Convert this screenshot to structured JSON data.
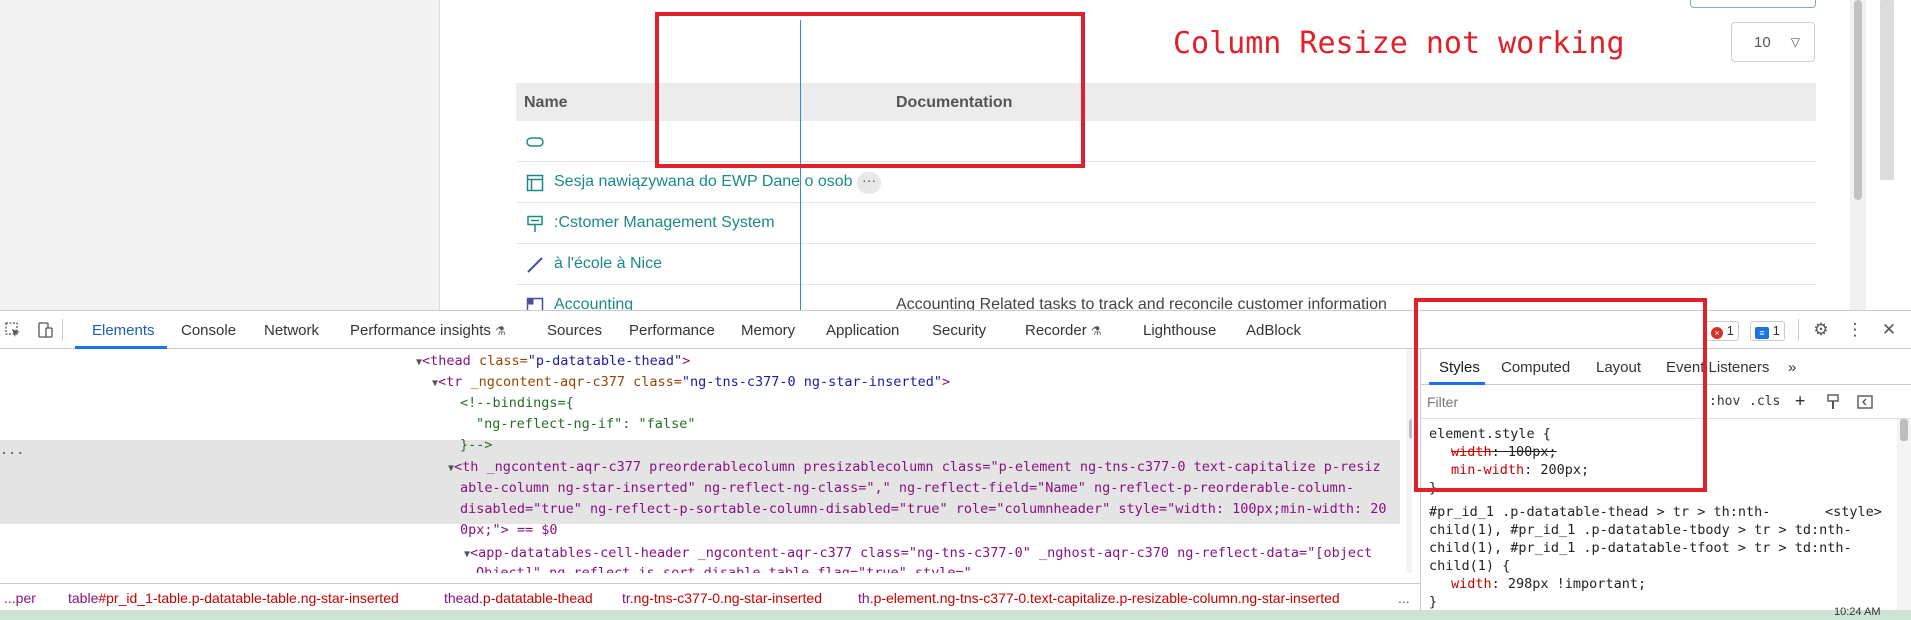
{
  "page": {
    "rows_per_page": "10",
    "annotation": "Column Resize not working",
    "table": {
      "headers": {
        "name": "Name",
        "documentation": "Documentation"
      },
      "rows": [
        {
          "icon": "pill-shape-icon",
          "name": "",
          "doc": ""
        },
        {
          "icon": "window-frame-icon",
          "name": "Sesja nawiązywana do EWP Dane o osob",
          "doc": "",
          "more": "···"
        },
        {
          "icon": "system-node-icon",
          "name": ":Cstomer Management System",
          "doc": ""
        },
        {
          "icon": "line-connector-icon",
          "name": "à l'école à Nice",
          "doc": ""
        },
        {
          "icon": "grid-icon",
          "name": "Accounting",
          "doc": "Accounting Related tasks to track and reconcile customer information"
        }
      ]
    }
  },
  "devtools": {
    "tabs": [
      "Elements",
      "Console",
      "Network",
      "Performance insights",
      "Sources",
      "Performance",
      "Memory",
      "Application",
      "Security",
      "Recorder",
      "Lighthouse",
      "AdBlock"
    ],
    "error_count": "1",
    "message_count": "1",
    "elements": {
      "line1": {
        "tag_open": "<thead ",
        "attr": "class=",
        "val": "\"p-datatable-thead\"",
        "close": ">"
      },
      "line2": {
        "tag_open": "<tr ",
        "attr1": "_ngcontent-aqr-c377 class=",
        "val1": "\"ng-tns-c377-0 ng-star-inserted\"",
        "close": ">"
      },
      "line3": "<!--bindings={",
      "line4": "\"ng-reflect-ng-if\": \"false\"",
      "line5": "}-->",
      "line6": "<th _ngcontent-aqr-c377 preorderablecolumn presizablecolumn class=\"p-element ng-tns-c377-0 text-capitalize p-resiz",
      "line7": "able-column ng-star-inserted\" ng-reflect-ng-class=\",\" ng-reflect-field=\"Name\" ng-reflect-p-reorderable-column-",
      "line8": "disabled=\"true\" ng-reflect-p-sortable-column-disabled=\"true\" role=\"columnheader\" style=\"width: 100px;min-width: 20",
      "line9": "0px;\"> == $0",
      "line10": "<app-datatables-cell-header _ngcontent-aqr-c377 class=\"ng-tns-c377-0\" _nghost-aqr-c370 ng-reflect-data=\"[object",
      "line11": "Object]\" ng-reflect-is-sort-disable-table-flag=\"true\" style=\"",
      "dots": "..."
    },
    "breadcrumb": [
      {
        "tag": "...per",
        "cls": ""
      },
      {
        "tag": "table",
        "cls": "#pr_id_1-table.p-datatable-table.ng-star-inserted"
      },
      {
        "tag": "thead",
        "cls": ".p-datatable-thead"
      },
      {
        "tag": "tr",
        "cls": ".ng-tns-c377-0.ng-star-inserted"
      },
      {
        "tag": "th",
        "cls": ".p-element.ng-tns-c377-0.text-capitalize.p-resizable-column.ng-star-inserted"
      },
      {
        "tag": "...",
        "cls": ""
      }
    ],
    "styles": {
      "subtabs": [
        "Styles",
        "Computed",
        "Layout",
        "Event Listeners",
        "»"
      ],
      "filter_placeholder": "Filter",
      "hov": ":hov",
      "cls": ".cls",
      "element_style_header": "element.style {",
      "prop1_name": "width",
      "prop1_value": "100px;",
      "prop2_name": "min-width",
      "prop2_value": "200px;",
      "close_brace": "}",
      "rule2_selector_1": "#pr_id_1 .p-datatable-thead > tr > th:nth-",
      "rule2_source": "<style>",
      "rule2_selector_2": "child(1), #pr_id_1 .p-datatable-tbody > tr > td:nth-",
      "rule2_selector_3": "child(1), #pr_id_1 .p-datatable-tfoot > tr > td:nth-",
      "rule2_selector_4": "child(1) {",
      "rule2_prop_name": "width",
      "rule2_prop_value": "298px !important;",
      "rule2_close": "}"
    }
  },
  "taskbar": {
    "time": "10:24 AM"
  }
}
